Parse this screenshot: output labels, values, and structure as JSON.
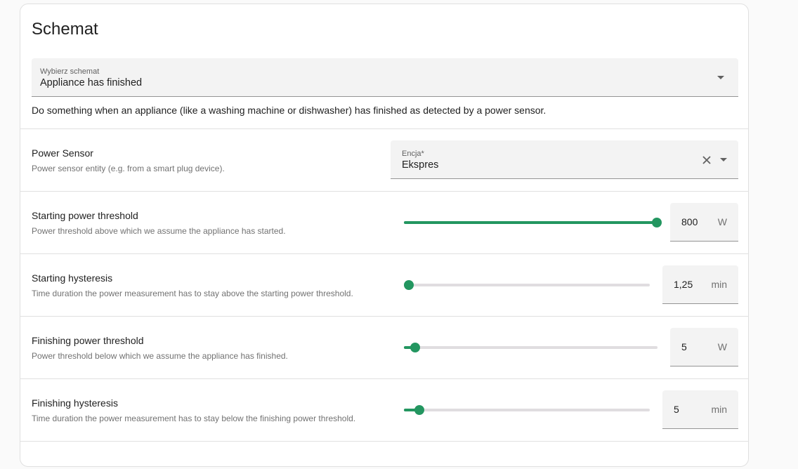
{
  "blueprint": {
    "title": "Schemat",
    "select_label": "Wybierz schemat",
    "select_value": "Appliance has finished",
    "description": "Do something when an appliance (like a washing machine or dishwasher) has finished as detected by a power sensor."
  },
  "power_sensor": {
    "title": "Power Sensor",
    "subtitle": "Power sensor entity (e.g. from a smart plug device).",
    "field_label": "Encja*",
    "field_value": "Ekspres"
  },
  "inputs": [
    {
      "title": "Starting power threshold",
      "subtitle": "Power threshold above which we assume the appliance has started.",
      "value": "800",
      "unit": "W",
      "level": 1.0
    },
    {
      "title": "Starting hysteresis",
      "subtitle": "Time duration the power measurement has to stay above the starting power threshold.",
      "value": "1,25",
      "unit": "min",
      "level": 0.0
    },
    {
      "title": "Finishing power threshold",
      "subtitle": "Power threshold below which we assume the appliance has finished.",
      "value": "5",
      "unit": "W",
      "level": 0.043
    },
    {
      "title": "Finishing hysteresis",
      "subtitle": "Time duration the power measurement has to stay below the finishing power threshold.",
      "value": "5",
      "unit": "min",
      "level": 0.063
    }
  ],
  "icons": {
    "dropdown": "chevron-down-icon",
    "clear": "close-icon"
  },
  "colors": {
    "accent": "#239660"
  }
}
